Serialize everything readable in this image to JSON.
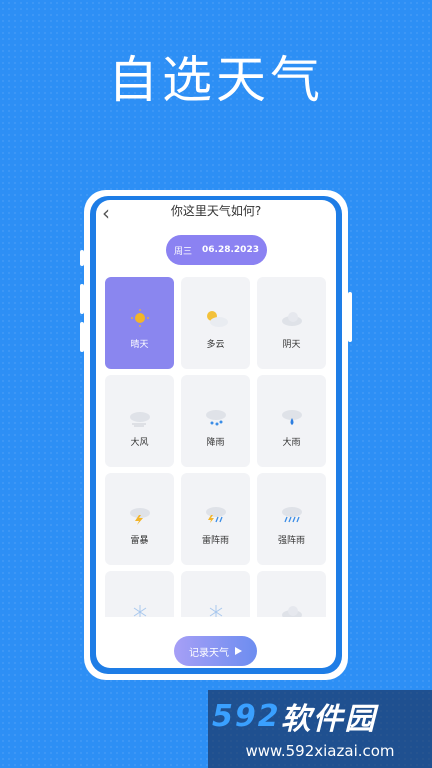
{
  "headline": "自选天气",
  "screen": {
    "title": "你这里天气如何?",
    "weekday": "周三",
    "date": "06.28.2023",
    "record_label": "记录天气"
  },
  "weather_items": [
    {
      "label": "晴天",
      "icon": "sunny-icon",
      "selected": true
    },
    {
      "label": "多云",
      "icon": "partly-cloudy-icon",
      "selected": false
    },
    {
      "label": "阴天",
      "icon": "cloudy-icon",
      "selected": false
    },
    {
      "label": "大风",
      "icon": "windy-icon",
      "selected": false
    },
    {
      "label": "降雨",
      "icon": "rain-icon",
      "selected": false
    },
    {
      "label": "大雨",
      "icon": "heavy-rain-icon",
      "selected": false
    },
    {
      "label": "雷暴",
      "icon": "thunderstorm-icon",
      "selected": false
    },
    {
      "label": "雷阵雨",
      "icon": "thunder-shower-icon",
      "selected": false
    },
    {
      "label": "强阵雨",
      "icon": "heavy-shower-icon",
      "selected": false
    },
    {
      "label": "",
      "icon": "snow-icon",
      "selected": false
    },
    {
      "label": "",
      "icon": "snow-icon",
      "selected": false
    },
    {
      "label": "",
      "icon": "cloudy-icon",
      "selected": false
    }
  ],
  "colors": {
    "background": "#2d8ff5",
    "accent": "#8a86ef",
    "phone_frame": "#1e7de6"
  },
  "watermark": {
    "number": "592",
    "text": "软件园",
    "url": "www.592xiazai.com"
  }
}
